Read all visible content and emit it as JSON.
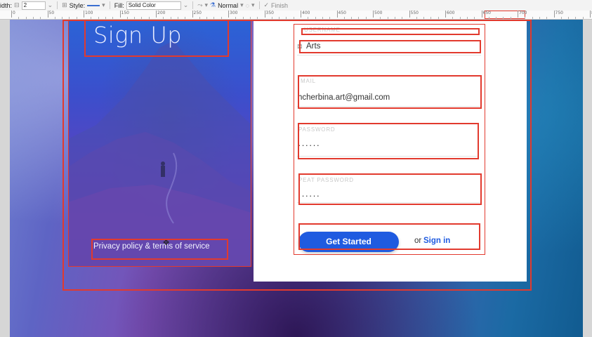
{
  "toolbar": {
    "width_label": "idth:",
    "width_value": "2",
    "style_label": "Style:",
    "fill_label": "Fill:",
    "fill_value": "Solid Color",
    "blend_value": "Normal",
    "finish_label": "Finish"
  },
  "ruler": {
    "ticks": [
      "0",
      "50",
      "100",
      "150",
      "200",
      "250",
      "300",
      "350",
      "400",
      "450",
      "500",
      "550",
      "600",
      "650",
      "700",
      "750",
      "800"
    ]
  },
  "hero": {
    "title": "Sign Up",
    "privacy_link": "Privacy policy & terms of service"
  },
  "form": {
    "fields": [
      {
        "label": "USERNAME",
        "value": "Arts"
      },
      {
        "label": "MAIL",
        "value": "hcherbina.art@gmail.com"
      },
      {
        "label": "PASSWORD",
        "value": "······"
      },
      {
        "label": "PEAT PASSWORD",
        "value": "······"
      }
    ],
    "submit_label": "Get Started",
    "or_text": "or",
    "signin_label": "Sign in"
  },
  "colors": {
    "selection_outline": "#e23a2e",
    "primary_button": "#1f5be0",
    "link": "#1f5be0"
  }
}
